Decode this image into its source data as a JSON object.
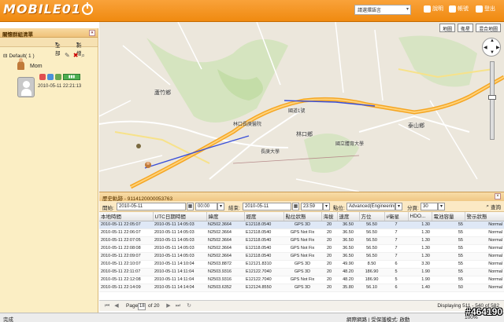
{
  "header": {
    "logo": "MOBILE01",
    "language": "請選擇語言",
    "help": "說明",
    "account": "帳號",
    "logout": "登出"
  },
  "left_panel": {
    "title": "關懷群組清單",
    "tool_all": "全部",
    "tool_new": "新增",
    "tree_root": "Default( 1 )",
    "member_name": "Mom",
    "device_time": "2010-05-11 22:21:13",
    "battery_label": "▮▮▮"
  },
  "map": {
    "buttons": [
      "地圖",
      "衛星",
      "混合地圖"
    ],
    "labels": {
      "town1": "蘆竹鄉",
      "town2": "林口鄉",
      "town3": "泰山鄉",
      "road1": "國道1號",
      "poi1": "國立體育大學",
      "poi2": "長庚大學",
      "poi3": "林口長庚醫院"
    },
    "zoom_level": 0.45
  },
  "history": {
    "title": "歷史軌跡 - 9114120000053763",
    "filter": {
      "start_label": "開始:",
      "start_date": "2010-05-11",
      "start_time": "00:00",
      "end_label": "結束:",
      "end_date": "2010-05-11",
      "end_time": "23:59",
      "mode_label": "點位:",
      "mode_value": "Advanced(Engineering mode)",
      "page_size_label": "分頁:",
      "page_size": "30",
      "query": "查詢"
    },
    "columns": [
      "本地時間",
      "UTC日期時間",
      "緯度",
      "經度",
      "點位狀態",
      "海拔",
      "速度",
      "方位",
      "#衛星",
      "HDO...",
      "電池容量",
      "警示狀態"
    ],
    "rows": [
      [
        "2010-05-11 22:05:07",
        "2010-05-11 14:05:03",
        "N2502.3664",
        "E12118.0540",
        "GPS 3D",
        "20",
        "36.50",
        "56.50",
        "7",
        "1.30",
        "55",
        "Normal"
      ],
      [
        "2010-05-11 22:06:07",
        "2010-05-11 14:05:03",
        "N2502.3664",
        "E12118.0540",
        "GPS Not Fix",
        "20",
        "36.50",
        "56.50",
        "7",
        "1.30",
        "55",
        "Normal"
      ],
      [
        "2010-05-11 22:07:05",
        "2010-05-11 14:05:03",
        "N2502.3664",
        "E12118.0540",
        "GPS Not Fix",
        "20",
        "36.50",
        "56.50",
        "7",
        "1.30",
        "55",
        "Normal"
      ],
      [
        "2010-05-11 22:08:08",
        "2010-05-11 14:05:03",
        "N2502.3664",
        "E12118.0540",
        "GPS Not Fix",
        "20",
        "36.50",
        "56.50",
        "7",
        "1.30",
        "55",
        "Normal"
      ],
      [
        "2010-05-11 22:09:07",
        "2010-05-11 14:05:03",
        "N2502.3664",
        "E12118.0540",
        "GPS Not Fix",
        "20",
        "36.50",
        "56.50",
        "7",
        "1.30",
        "55",
        "Normal"
      ],
      [
        "2010-05-11 22:10:07",
        "2010-05-11 14:10:04",
        "N2503.8872",
        "E12121.8310",
        "GPS 3D",
        "20",
        "49.90",
        "8.50",
        "6",
        "3.30",
        "55",
        "Normal"
      ],
      [
        "2010-05-11 22:11:07",
        "2010-05-11 14:11:04",
        "N2503.9316",
        "E12122.7040",
        "GPS 3D",
        "20",
        "48.20",
        "186.90",
        "5",
        "1.90",
        "55",
        "Normal"
      ],
      [
        "2010-05-11 22:12:08",
        "2010-05-11 14:11:04",
        "N2503.9316",
        "E12122.7040",
        "GPS Not Fix",
        "20",
        "48.20",
        "186.90",
        "5",
        "1.90",
        "55",
        "Normal"
      ],
      [
        "2010-05-11 22:14:09",
        "2010-05-11 14:14:04",
        "N2503.6352",
        "E12124.8550",
        "GPS 3D",
        "20",
        "35.80",
        "56.10",
        "6",
        "1.40",
        "50",
        "Normal"
      ]
    ],
    "pager": {
      "page_label": "Page",
      "page": "18",
      "of": "of 20",
      "summary": "Displaying 511 - 540 of 582"
    }
  },
  "status_bar": {
    "left": "完成",
    "right": "網際網路 | 受保護模式: 啟動",
    "zoom": "100%"
  },
  "watermark": "#464190",
  "colors": {
    "header": "#f08a10",
    "panel": "#fbeec4",
    "route": "#3a4fd8",
    "highway": "#f5a623"
  }
}
